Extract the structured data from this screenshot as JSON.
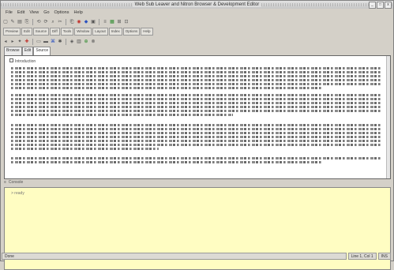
{
  "window": {
    "title": "Web Sub Leaver and Nitron Browser & Development Editor",
    "buttons": [
      "_",
      "□",
      "x"
    ]
  },
  "menu": [
    "File",
    "Edit",
    "View",
    "Go",
    "Options",
    "Help"
  ],
  "toolbar_row1": [
    {
      "glyph": "▢",
      "color": ""
    },
    {
      "glyph": "✎",
      "color": ""
    },
    {
      "glyph": "▤",
      "color": ""
    },
    {
      "glyph": "⎘",
      "color": ""
    },
    {
      "glyph": "⟲",
      "color": ""
    },
    {
      "glyph": "⟳",
      "color": ""
    },
    {
      "glyph": "⌕",
      "color": ""
    },
    {
      "glyph": "✂",
      "color": ""
    },
    {
      "glyph": "⎗",
      "color": ""
    },
    {
      "glyph": "◉",
      "color": "red"
    },
    {
      "glyph": "◆",
      "color": "blue"
    },
    {
      "glyph": "▣",
      "color": ""
    },
    {
      "glyph": "≡",
      "color": ""
    },
    {
      "glyph": "▦",
      "color": "green"
    },
    {
      "glyph": "⊞",
      "color": ""
    },
    {
      "glyph": "⊡",
      "color": ""
    }
  ],
  "toolbar_row3": [
    {
      "glyph": "◂",
      "color": ""
    },
    {
      "glyph": "▸",
      "color": ""
    },
    {
      "glyph": "✦",
      "color": ""
    },
    {
      "glyph": "✚",
      "color": "red"
    },
    {
      "glyph": "▭",
      "color": ""
    },
    {
      "glyph": "▬",
      "color": ""
    },
    {
      "glyph": "⌘",
      "color": "blue"
    },
    {
      "glyph": "✱",
      "color": ""
    },
    {
      "glyph": "◈",
      "color": ""
    },
    {
      "glyph": "▥",
      "color": ""
    },
    {
      "glyph": "⊕",
      "color": "green"
    },
    {
      "glyph": "⊗",
      "color": ""
    }
  ],
  "doc_tabs": [
    "Preview",
    "Edit",
    "Source",
    "Diff",
    "Tools",
    "Window",
    "Layout",
    "Index",
    "Options",
    "Help"
  ],
  "sub_tabs": [
    "Browse",
    "Edit",
    "Source"
  ],
  "document": {
    "title": "Introduction"
  },
  "splitter_label": "Console",
  "console": {
    "text": "> ready"
  },
  "status": {
    "left": "Done",
    "mid": "Line 1, Col 1",
    "right": "INS"
  }
}
